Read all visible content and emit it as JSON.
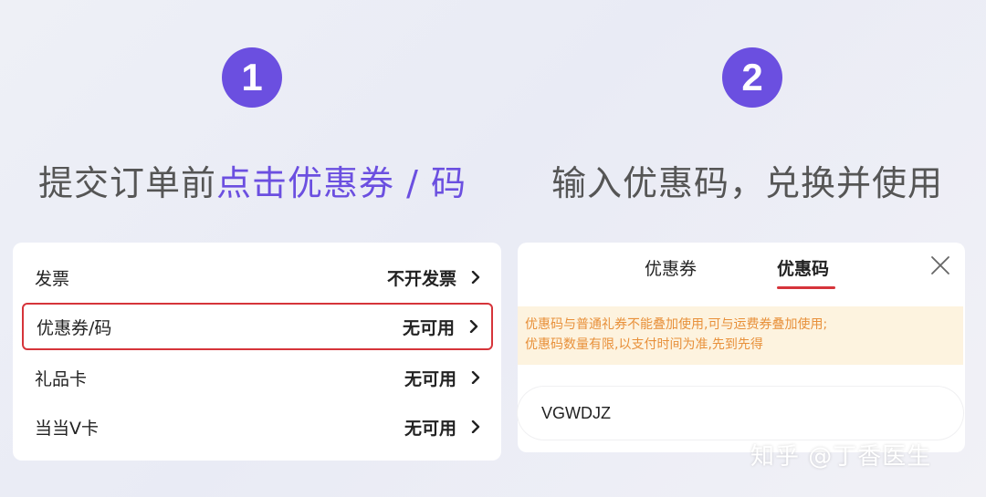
{
  "steps": [
    {
      "number": "1",
      "heading_plain": "提交订单前",
      "heading_highlight": "点击优惠券 / 码"
    },
    {
      "number": "2",
      "heading": "输入优惠码，兑换并使用"
    }
  ],
  "order_options": [
    {
      "label": "发票",
      "value": "不开发票"
    },
    {
      "label": "优惠券/码",
      "value": "无可用"
    },
    {
      "label": "礼品卡",
      "value": "无可用"
    },
    {
      "label": "当当V卡",
      "value": "无可用"
    }
  ],
  "coupon_panel": {
    "tabs": [
      "优惠券",
      "优惠码"
    ],
    "active_tab": "优惠码",
    "notice_line1": "优惠码与普通礼券不能叠加使用,可与运费券叠加使用;",
    "notice_line2": "优惠码数量有限,以支付时间为准,先到先得",
    "code_value": "VGWDJZ"
  },
  "watermark": "知乎 @丁香医生",
  "colors": {
    "accent": "#6b4fe0",
    "highlight_border": "#d6343a",
    "notice_bg": "#fdf3df",
    "notice_text": "#e8903a"
  }
}
